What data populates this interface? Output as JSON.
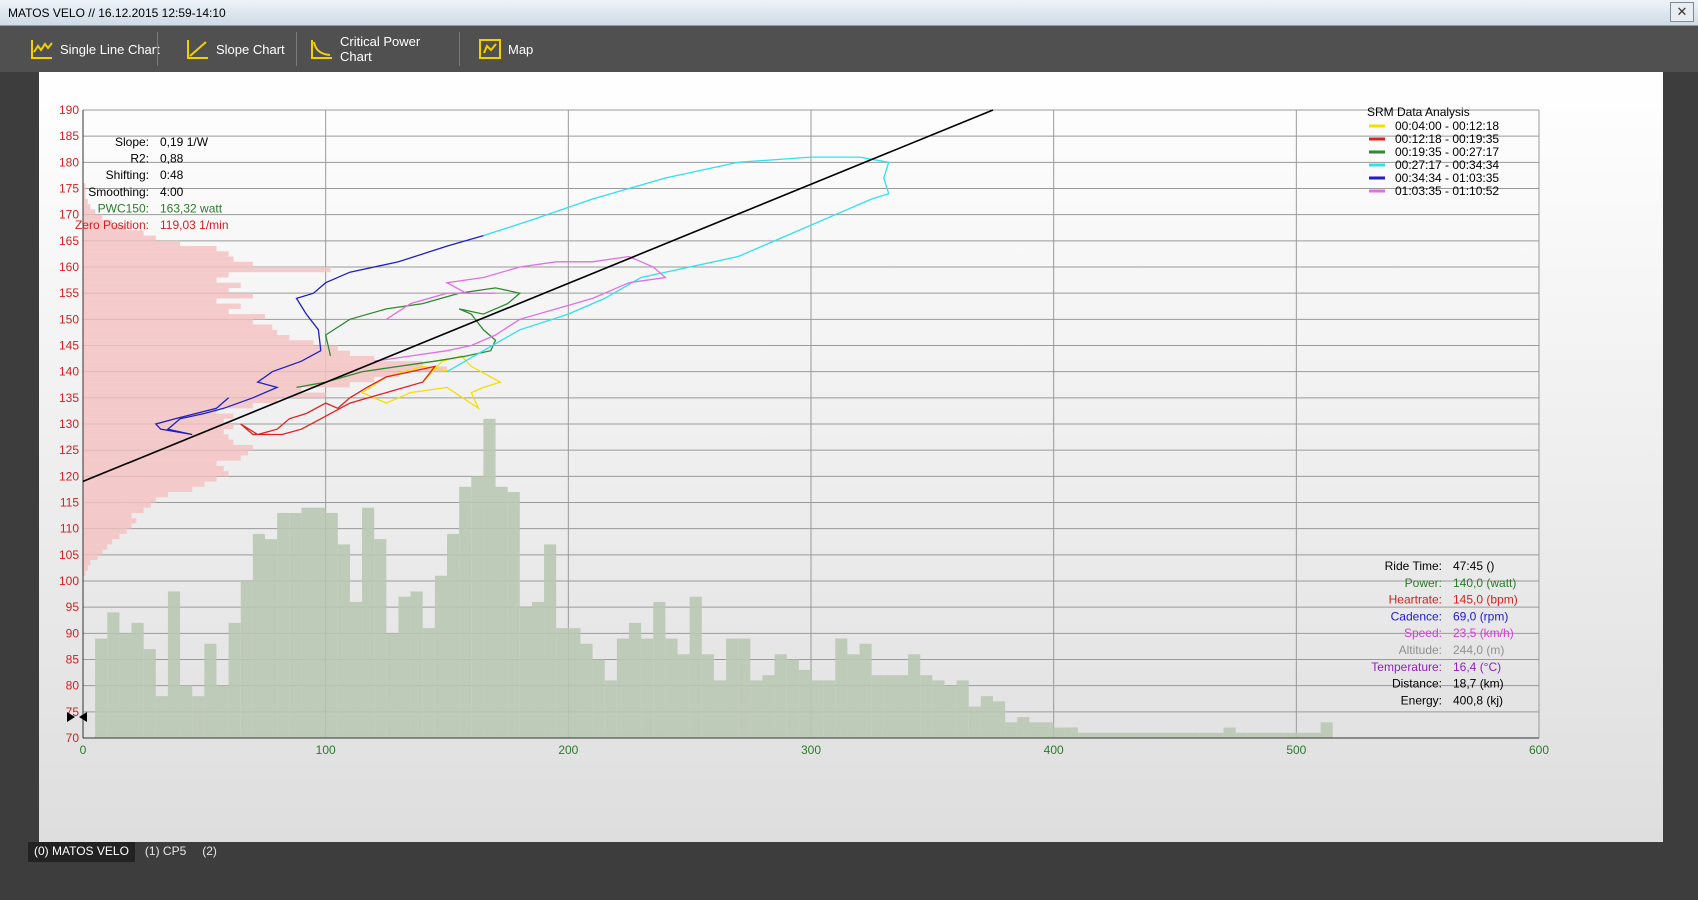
{
  "window": {
    "title": "MATOS VELO // 16.12.2015 12:59-14:10",
    "close_glyph": "✕"
  },
  "toolbar": {
    "single_line_label": "Single Line Chart",
    "slope_label": "Slope Chart",
    "critical_power_label": "Critical Power Chart",
    "map_label": "Map"
  },
  "tabs": [
    {
      "label": "(0) MATOS VELO",
      "active": true
    },
    {
      "label": "(1) CP5",
      "active": false
    },
    {
      "label": "(2)",
      "active": false
    }
  ],
  "colors": {
    "accent": "#f2d000",
    "left_axis": "#d42020",
    "bottom_axis": "#2d7a2d",
    "power_hist": "#b9c8b4",
    "cadence_hist": "#f5c2c2"
  },
  "stats_left": [
    {
      "label": "Slope:",
      "value": "0,19 1/W",
      "color": "#000000"
    },
    {
      "label": "R2:",
      "value": "0,88",
      "color": "#000000"
    },
    {
      "label": "Shifting:",
      "value": "0:48",
      "color": "#000000"
    },
    {
      "label": "Smoothing:",
      "value": "4:00",
      "color": "#000000"
    },
    {
      "label": "PWC150:",
      "value": "163,32 watt",
      "color": "#2d7a2d"
    },
    {
      "label": "Zero Position:",
      "value": "119,03 1/min",
      "color": "#d42020"
    }
  ],
  "stats_right": [
    {
      "label": "Ride Time:",
      "value": "47:45 ()",
      "color": "#000000"
    },
    {
      "label": "Power:",
      "value": "140,0 (watt)",
      "color": "#2d7a2d"
    },
    {
      "label": "Heartrate:",
      "value": "145,0 (bpm)",
      "color": "#d42020"
    },
    {
      "label": "Cadence:",
      "value": "69,0 (rpm)",
      "color": "#2020c8"
    },
    {
      "label": "Speed:",
      "value": "23,5 (km/h)",
      "color": "#d040d0"
    },
    {
      "label": "Altitude:",
      "value": "244,0 (m)",
      "color": "#909090"
    },
    {
      "label": "Temperature:",
      "value": "16,4 (°C)",
      "color": "#9020c0"
    },
    {
      "label": "Distance:",
      "value": "18,7 (km)",
      "color": "#000000"
    },
    {
      "label": "Energy:",
      "value": "400,8 (kj)",
      "color": "#000000"
    }
  ],
  "chart_data": {
    "type": "line",
    "title": "SRM Data Analysis",
    "xlim": [
      0,
      600
    ],
    "ylim": [
      70,
      190
    ],
    "x_ticks": [
      0,
      100,
      200,
      300,
      400,
      500,
      600
    ],
    "y_ticks": [
      70,
      75,
      80,
      85,
      90,
      95,
      100,
      105,
      110,
      115,
      120,
      125,
      130,
      135,
      140,
      145,
      150,
      155,
      160,
      165,
      170,
      175,
      180,
      185,
      190
    ],
    "grid": true,
    "legend_position": "top-right",
    "regression_line": {
      "x": [
        0,
        375
      ],
      "y": [
        119.03,
        190
      ]
    },
    "series": [
      {
        "name": "00:04:00 - 00:12:18",
        "color": "#f2e000",
        "points": [
          [
            140,
            138
          ],
          [
            148,
            142
          ],
          [
            156,
            143
          ],
          [
            160,
            141
          ],
          [
            168,
            139
          ],
          [
            172,
            138
          ],
          [
            165,
            137
          ],
          [
            160,
            136
          ],
          [
            163,
            133
          ],
          [
            150,
            137
          ],
          [
            135,
            136
          ],
          [
            125,
            134
          ],
          [
            115,
            136
          ],
          [
            125,
            139
          ],
          [
            140,
            141
          ],
          [
            152,
            140
          ]
        ]
      },
      {
        "name": "00:12:18 - 00:19:35",
        "color": "#e02020",
        "points": [
          [
            65,
            130
          ],
          [
            72,
            128
          ],
          [
            80,
            129
          ],
          [
            85,
            131
          ],
          [
            92,
            132
          ],
          [
            100,
            134
          ],
          [
            105,
            133
          ],
          [
            110,
            135
          ],
          [
            117,
            137
          ],
          [
            125,
            139
          ],
          [
            135,
            140
          ],
          [
            145,
            141
          ],
          [
            140,
            138
          ],
          [
            125,
            136
          ],
          [
            110,
            134
          ],
          [
            98,
            131
          ],
          [
            90,
            129
          ],
          [
            82,
            128
          ],
          [
            70,
            128
          ],
          [
            65,
            130
          ]
        ]
      },
      {
        "name": "00:19:35 - 00:27:17",
        "color": "#2d8a2d",
        "points": [
          [
            88,
            137
          ],
          [
            100,
            138
          ],
          [
            115,
            140
          ],
          [
            130,
            141
          ],
          [
            145,
            142
          ],
          [
            158,
            143
          ],
          [
            168,
            144
          ],
          [
            170,
            146
          ],
          [
            165,
            148
          ],
          [
            160,
            151
          ],
          [
            155,
            152
          ],
          [
            165,
            151
          ],
          [
            175,
            153
          ],
          [
            180,
            155
          ],
          [
            170,
            156
          ],
          [
            155,
            155
          ],
          [
            140,
            153
          ],
          [
            125,
            152
          ],
          [
            110,
            150
          ],
          [
            100,
            147
          ],
          [
            102,
            143
          ]
        ]
      },
      {
        "name": "00:27:17 - 00:34:34",
        "color": "#30e0f0",
        "points": [
          [
            150,
            140
          ],
          [
            165,
            144
          ],
          [
            180,
            148
          ],
          [
            200,
            151
          ],
          [
            215,
            154
          ],
          [
            230,
            158
          ],
          [
            250,
            160
          ],
          [
            270,
            162
          ],
          [
            290,
            166
          ],
          [
            310,
            170
          ],
          [
            325,
            173
          ],
          [
            332,
            174
          ],
          [
            330,
            177
          ],
          [
            332,
            180
          ],
          [
            320,
            181
          ],
          [
            300,
            181
          ],
          [
            270,
            180
          ],
          [
            240,
            177
          ],
          [
            210,
            173
          ],
          [
            185,
            169
          ],
          [
            165,
            166
          ]
        ]
      },
      {
        "name": "00:34:34 - 01:03:35",
        "color": "#2020c0",
        "points": [
          [
            165,
            166
          ],
          [
            150,
            164
          ],
          [
            130,
            161
          ],
          [
            110,
            159
          ],
          [
            100,
            157
          ],
          [
            95,
            155
          ],
          [
            88,
            154
          ],
          [
            92,
            151
          ],
          [
            97,
            148
          ],
          [
            98,
            144
          ],
          [
            90,
            142
          ],
          [
            78,
            140
          ],
          [
            72,
            138
          ],
          [
            80,
            137
          ],
          [
            70,
            135
          ],
          [
            58,
            133
          ],
          [
            50,
            132
          ],
          [
            40,
            131
          ],
          [
            35,
            129
          ],
          [
            45,
            128
          ],
          [
            32,
            129
          ],
          [
            30,
            130
          ],
          [
            38,
            131
          ],
          [
            55,
            133
          ],
          [
            60,
            135
          ]
        ]
      },
      {
        "name": "01:03:35 - 01:10:52",
        "color": "#e070e0",
        "points": [
          [
            120,
            142
          ],
          [
            135,
            143
          ],
          [
            150,
            144
          ],
          [
            160,
            145
          ],
          [
            170,
            147
          ],
          [
            180,
            150
          ],
          [
            195,
            152
          ],
          [
            210,
            154
          ],
          [
            225,
            157
          ],
          [
            240,
            158
          ],
          [
            235,
            160
          ],
          [
            225,
            162
          ],
          [
            210,
            161
          ],
          [
            195,
            161
          ],
          [
            180,
            160
          ],
          [
            165,
            158
          ],
          [
            150,
            157
          ],
          [
            158,
            155
          ],
          [
            170,
            155
          ],
          [
            150,
            155
          ],
          [
            135,
            153
          ],
          [
            125,
            150
          ]
        ]
      }
    ],
    "power_histogram": {
      "x_start": 0,
      "bin_width": 5,
      "heights": [
        0,
        89,
        94,
        90,
        92,
        87,
        78,
        98,
        80,
        78,
        88,
        80,
        92,
        100,
        109,
        108,
        113,
        113,
        114,
        114,
        113,
        107,
        96,
        114,
        108,
        90,
        97,
        98,
        91,
        101,
        109,
        118,
        120,
        131,
        118,
        117,
        95,
        96,
        107,
        91,
        91,
        88,
        85,
        81,
        89,
        92,
        89,
        96,
        89,
        86,
        97,
        86,
        81,
        89,
        89,
        81,
        82,
        86,
        85,
        83,
        81,
        81,
        89,
        86,
        88,
        82,
        82,
        82,
        86,
        82,
        81,
        80,
        81,
        76,
        78,
        77,
        73,
        74,
        73,
        73,
        72,
        72,
        71,
        71,
        71,
        71,
        71,
        71,
        71,
        71,
        71,
        71,
        71,
        71,
        72,
        71,
        71,
        71,
        71,
        71,
        71,
        71,
        73,
        70,
        70,
        70,
        70,
        70,
        70,
        70,
        70,
        70,
        70,
        70,
        70,
        70,
        70,
        70,
        70,
        70
      ]
    },
    "cadence_histogram": {
      "y_start": 70,
      "bin_width": 1,
      "widths": [
        0,
        0,
        0,
        0,
        0,
        0,
        0,
        0,
        0,
        0,
        0,
        0,
        0,
        0,
        0,
        0,
        0,
        0,
        0,
        0,
        0,
        0,
        0,
        0,
        0,
        0,
        0,
        0,
        0,
        0,
        0,
        1,
        2,
        3,
        6,
        8,
        10,
        12,
        15,
        18,
        20,
        22,
        20,
        25,
        28,
        30,
        35,
        45,
        50,
        55,
        60,
        58,
        55,
        65,
        68,
        70,
        62,
        60,
        58,
        62,
        58,
        62,
        55,
        70,
        80,
        100,
        90,
        110,
        120,
        130,
        150,
        140,
        120,
        110,
        105,
        95,
        85,
        80,
        78,
        70,
        75,
        60,
        65,
        55,
        70,
        60,
        65,
        55,
        60,
        102,
        70,
        62,
        60,
        55,
        40,
        30,
        25,
        18,
        12,
        8,
        5,
        3,
        2,
        1,
        1,
        1,
        0,
        0,
        0,
        0,
        0,
        0,
        0,
        0,
        0,
        0,
        0,
        0,
        0,
        0,
        0
      ]
    }
  }
}
